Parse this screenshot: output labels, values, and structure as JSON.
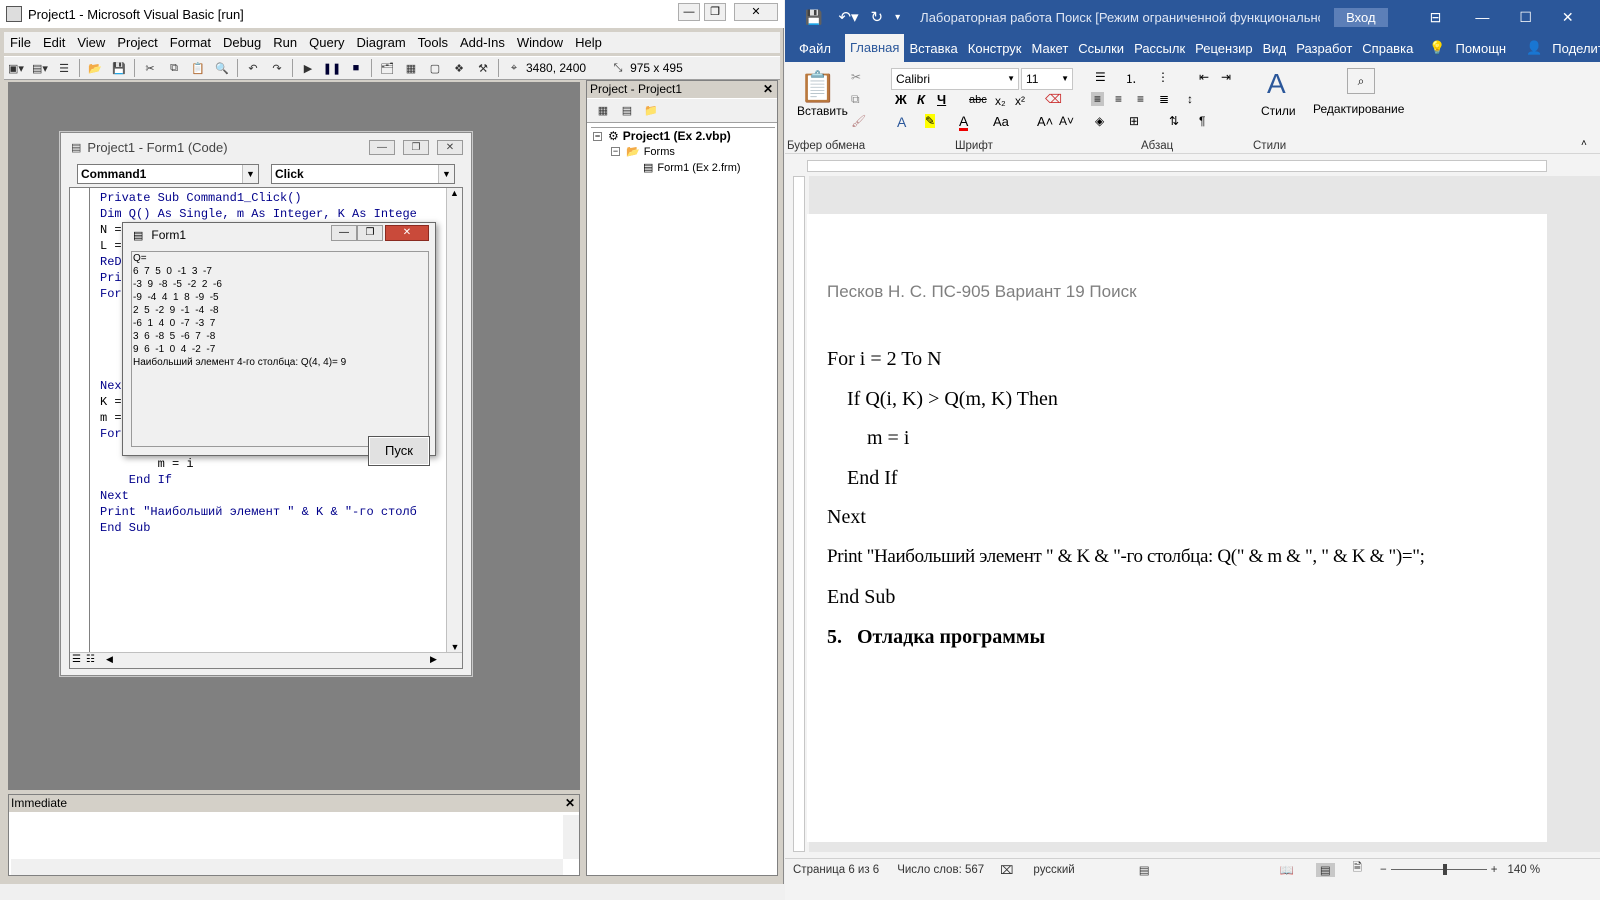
{
  "vb": {
    "title": "Project1 - Microsoft Visual Basic [run]",
    "menu": [
      "File",
      "Edit",
      "View",
      "Project",
      "Format",
      "Debug",
      "Run",
      "Query",
      "Diagram",
      "Tools",
      "Add-Ins",
      "Window",
      "Help"
    ],
    "position": "3480, 2400",
    "size": "975 x 495",
    "code_window": {
      "title": "Project1 - Form1 (Code)",
      "object_combo": "Command1",
      "proc_combo": "Click",
      "lines": [
        "Private Sub Command1_Click()",
        "Dim Q() As Single, m As Integer, K As Intege",
        "N =",
        "L =",
        "ReD",
        "Pri",
        "For",
        "Nex",
        "K =",
        "m =",
        "For",
        "        m = i",
        "    End If",
        "Next",
        "Print \"Наибольший элемент \" & K & \"-го столб",
        "End Sub"
      ]
    },
    "form1": {
      "title": "Form1",
      "output": [
        "Q=",
        "6  7  5  0  -1  3  -7",
        "-3  9  -8  -5  -2  2  -6",
        "-9  -4  4  1  8  -9  -5",
        "2  5  -2  9  -1  -4  -8",
        "-6  1  4  0  -7  -3  7",
        "3  6  -8  5  -6  7  -8",
        "9  6  -1  0  4  -2  -7",
        "Наибольший элемент 4-го столбца: Q(4, 4)= 9"
      ],
      "button": "Пуск"
    },
    "project_panel": {
      "title": "Project - Project1",
      "root": "Project1 (Ex 2.vbp)",
      "folder": "Forms",
      "item": "Form1 (Ex 2.frm)"
    },
    "immediate_title": "Immediate"
  },
  "word": {
    "title": "Лабораторная работа Поиск [Режим ограниченной функциональност...",
    "signin": "Вход",
    "tabs": [
      "Файл",
      "Главная",
      "Вставка",
      "Конструк",
      "Макет",
      "Ссылки",
      "Рассылк",
      "Рецензир",
      "Вид",
      "Разработ",
      "Справка"
    ],
    "help_search": "Помощн",
    "share": "Поделиться",
    "font_name": "Calibri",
    "font_size": "11",
    "paste": "Вставить",
    "styles": "Стили",
    "editing": "Редактирование",
    "groups": [
      "Буфер обмена",
      "Шрифт",
      "Абзац",
      "Стили"
    ],
    "header_text": "Песков Н. С. ПС-905 Вариант 19 Поиск",
    "doc_lines": [
      "For i = 2 To N",
      "    If Q(i, K) > Q(m, K) Then",
      "        m = i",
      "    End If",
      "Next",
      "Print \"Наибольший элемент \" & K & \"-го столбца: Q(\" & m & \", \" & K & \")=\";",
      "End Sub"
    ],
    "heading": "5.   Отладка программы",
    "status": {
      "page": "Страница 6 из 6",
      "words": "Число слов: 567",
      "lang": "русский",
      "zoom": "140 %"
    },
    "accent": "#2b579a"
  }
}
